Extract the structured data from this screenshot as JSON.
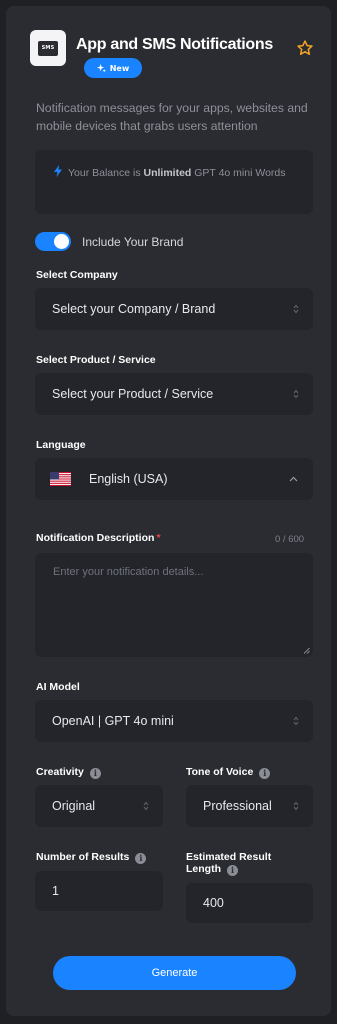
{
  "header": {
    "app_icon_text": "SMS",
    "title": "App and SMS Notifications",
    "badge": "New",
    "description": "Notification messages for your apps, websites and mobile devices that grabs users attention"
  },
  "balance": {
    "prefix": "Your Balance is",
    "amount": "Unlimited",
    "suffix": "GPT 4o mini Words"
  },
  "brand_toggle": {
    "label": "Include Your Brand",
    "on": true
  },
  "company": {
    "label": "Select Company",
    "value": "Select your Company / Brand"
  },
  "product": {
    "label": "Select Product / Service",
    "value": "Select your Product / Service"
  },
  "language": {
    "label": "Language",
    "value": "English (USA)"
  },
  "notification": {
    "label": "Notification Description",
    "required_mark": "*",
    "counter": "0 / 600",
    "placeholder": "Enter your notification details..."
  },
  "ai_model": {
    "label": "AI Model",
    "value": "OpenAI | GPT 4o mini"
  },
  "creativity": {
    "label": "Creativity",
    "value": "Original"
  },
  "tone": {
    "label": "Tone of Voice",
    "value": "Professional"
  },
  "results": {
    "label": "Number of Results",
    "value": "1"
  },
  "length": {
    "label_line1": "Estimated Result",
    "label_line2": "Length",
    "value": "400"
  },
  "generate_label": "Generate",
  "colors": {
    "accent": "#1a83ff",
    "star": "#f5a623",
    "panel": "#2b2c31",
    "field": "#24252a"
  }
}
